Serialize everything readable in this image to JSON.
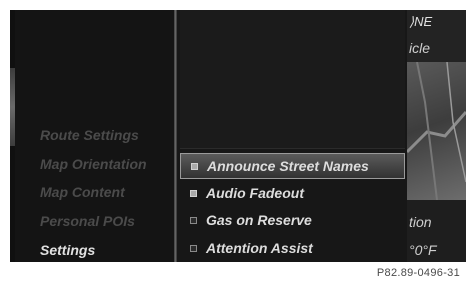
{
  "menu": {
    "items": [
      {
        "label": "Route Settings",
        "active": false
      },
      {
        "label": "Map Orientation",
        "active": false
      },
      {
        "label": "Map Content",
        "active": false
      },
      {
        "label": "Personal POIs",
        "active": false
      },
      {
        "label": "Settings",
        "active": true
      }
    ]
  },
  "options": [
    {
      "label": "Announce Street Names",
      "checked": true,
      "selected": true
    },
    {
      "label": "Audio Fadeout",
      "checked": true,
      "selected": false
    },
    {
      "label": "Gas on Reserve",
      "checked": false,
      "selected": false
    },
    {
      "label": "Attention Assist",
      "checked": false,
      "selected": false
    }
  ],
  "map": {
    "compass_heading": "NE",
    "partial_label_top": "icle",
    "partial_label_mid": "tion",
    "partial_temperature": "°0°F"
  },
  "figure_code": "P82.89-0496-31",
  "colors": {
    "screen_bg": "#101010",
    "active_text": "#e2e2e2",
    "inactive_text": "#4b4b4b",
    "highlight_border": "#9a9a9a"
  }
}
